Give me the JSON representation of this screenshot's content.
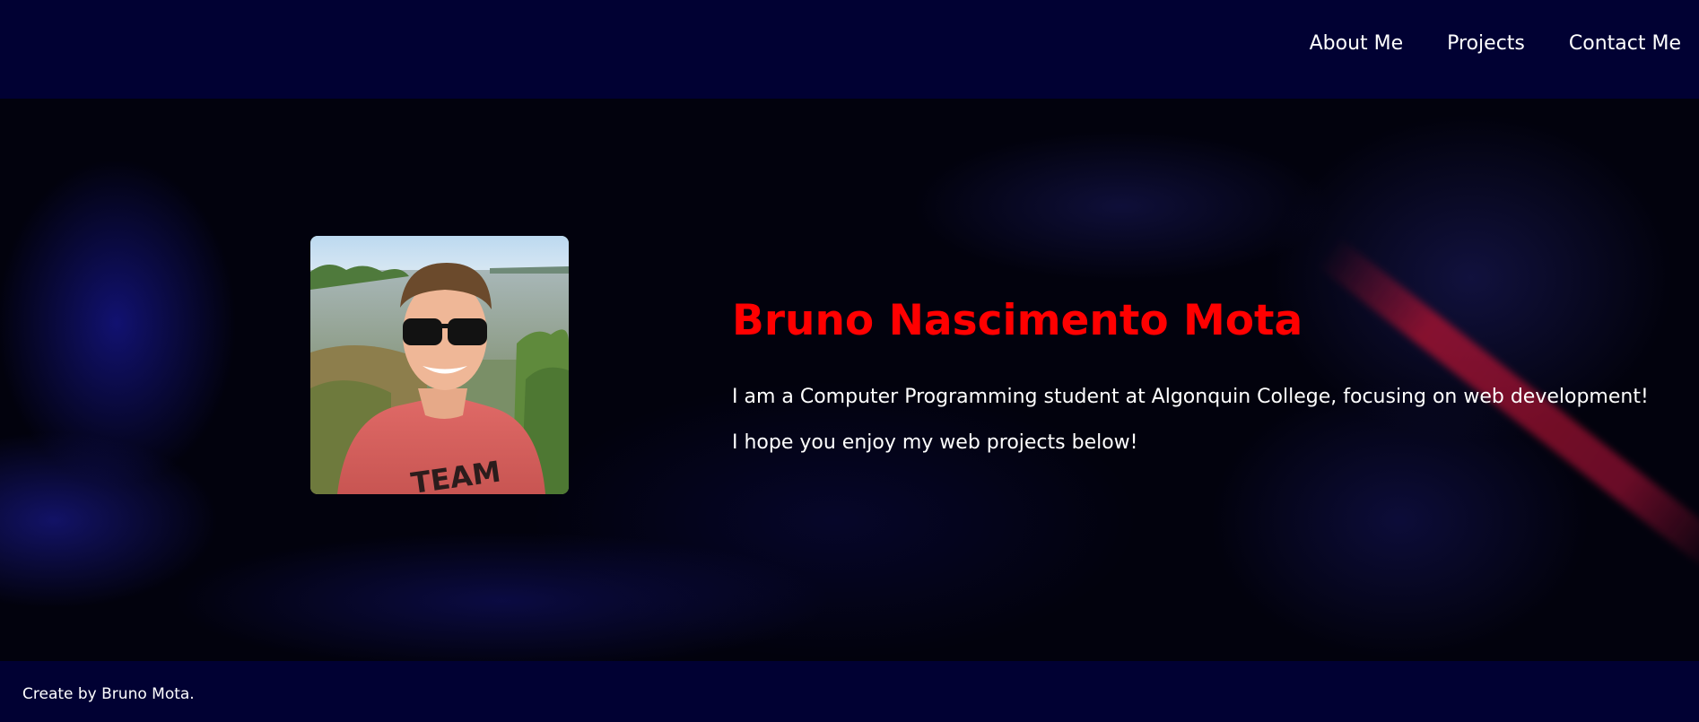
{
  "nav": {
    "items": [
      {
        "label": "About Me"
      },
      {
        "label": "Projects"
      },
      {
        "label": "Contact Me"
      }
    ]
  },
  "hero": {
    "name": "Bruno Nascimento Mota",
    "bio_line_1": "I am a Computer Programming student at Algonquin College, focusing on web development!",
    "bio_line_2": "I hope you enjoy my web projects below!"
  },
  "footer": {
    "text": "Create by Bruno Mota."
  },
  "colors": {
    "header_bg": "#010133",
    "footer_bg": "#010133",
    "name_color": "#ff0000",
    "text_color": "#ffffff",
    "hero_bg": "#02020d"
  }
}
